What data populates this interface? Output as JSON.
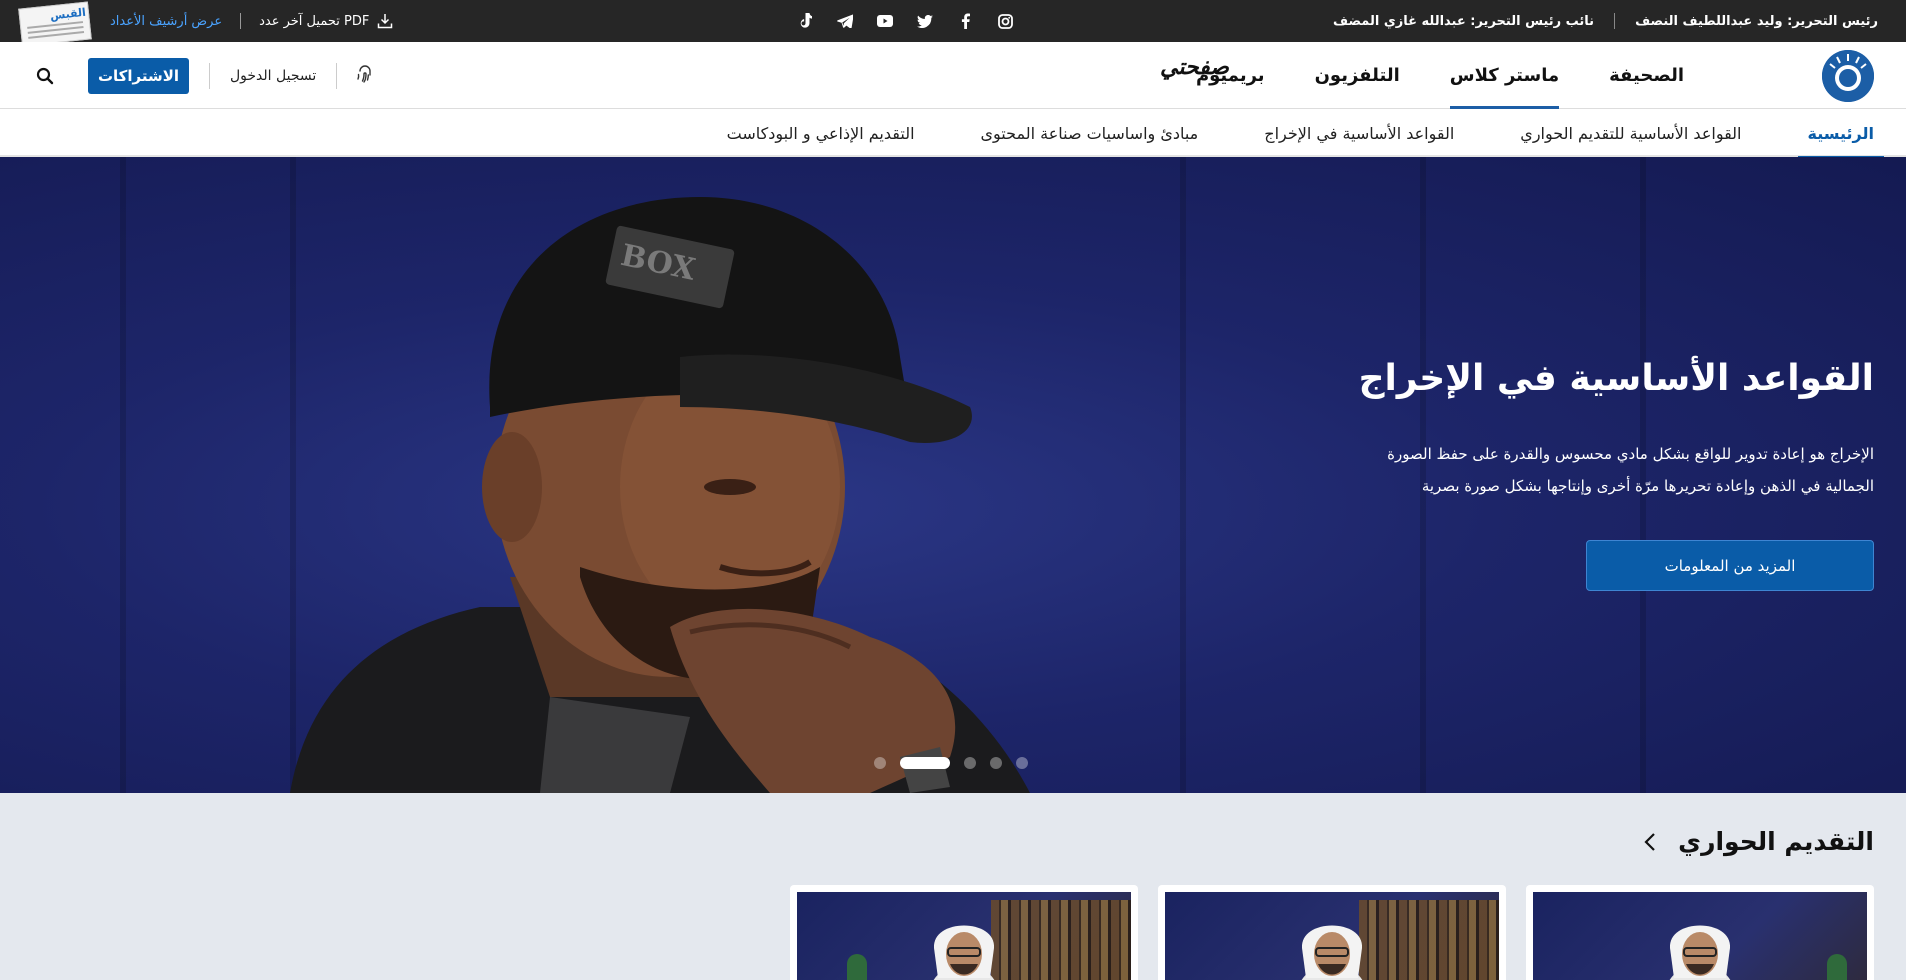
{
  "topbar": {
    "editor_in_chief": "رئيس التحرير: وليد عبداللطيف النصف",
    "deputy_editor": "نائب رئيس التحرير: عبدالله غازي المضف",
    "archive_link": "عرض أرشيف الأعداد",
    "download_pdf": "تحميل آخر عدد PDF",
    "newspaper_thumb_label": "القبس",
    "social_icons": [
      "instagram-icon",
      "facebook-icon",
      "twitter-icon",
      "youtube-icon",
      "telegram-icon",
      "tiktok-icon"
    ]
  },
  "mainnav": {
    "links": [
      {
        "label": "الصحيفة",
        "active": false
      },
      {
        "label": "ماستر كلاس",
        "active": true
      },
      {
        "label": "التلفزيون",
        "active": false
      },
      {
        "label": "بريميوم",
        "active": false
      }
    ],
    "safhati": "صفحتي",
    "subscriptions_button": "الاشتراكات",
    "login": "تسجيل الدخول"
  },
  "subnav": {
    "items": [
      {
        "label": "الرئيسية",
        "active": true
      },
      {
        "label": "القواعد الأساسية للتقديم الحواري",
        "active": false
      },
      {
        "label": "القواعد الأساسية في الإخراج",
        "active": false
      },
      {
        "label": "مبادئ واساسيات صناعة المحتوى",
        "active": false
      },
      {
        "label": "التقديم الإذاعي و البودكاست",
        "active": false
      }
    ]
  },
  "hero": {
    "title": "القواعد الأساسية في الإخراج",
    "description_line1": "الإخراج هو إعادة تدوير للواقع بشكل مادي محسوس والقدرة على حفظ الصورة",
    "description_line2": "الجمالية في الذهن وإعادة تحريرها مرّة أخرى وإنتاجها بشكل صورة بصرية",
    "button": "المزيد من المعلومات",
    "slides_count": 5,
    "active_slide": 2
  },
  "section": {
    "title": "التقديم الحواري"
  },
  "colors": {
    "brand_blue": "#0a5ca8",
    "topbar_bg": "#262626",
    "hero_bg": "#1d2569"
  }
}
